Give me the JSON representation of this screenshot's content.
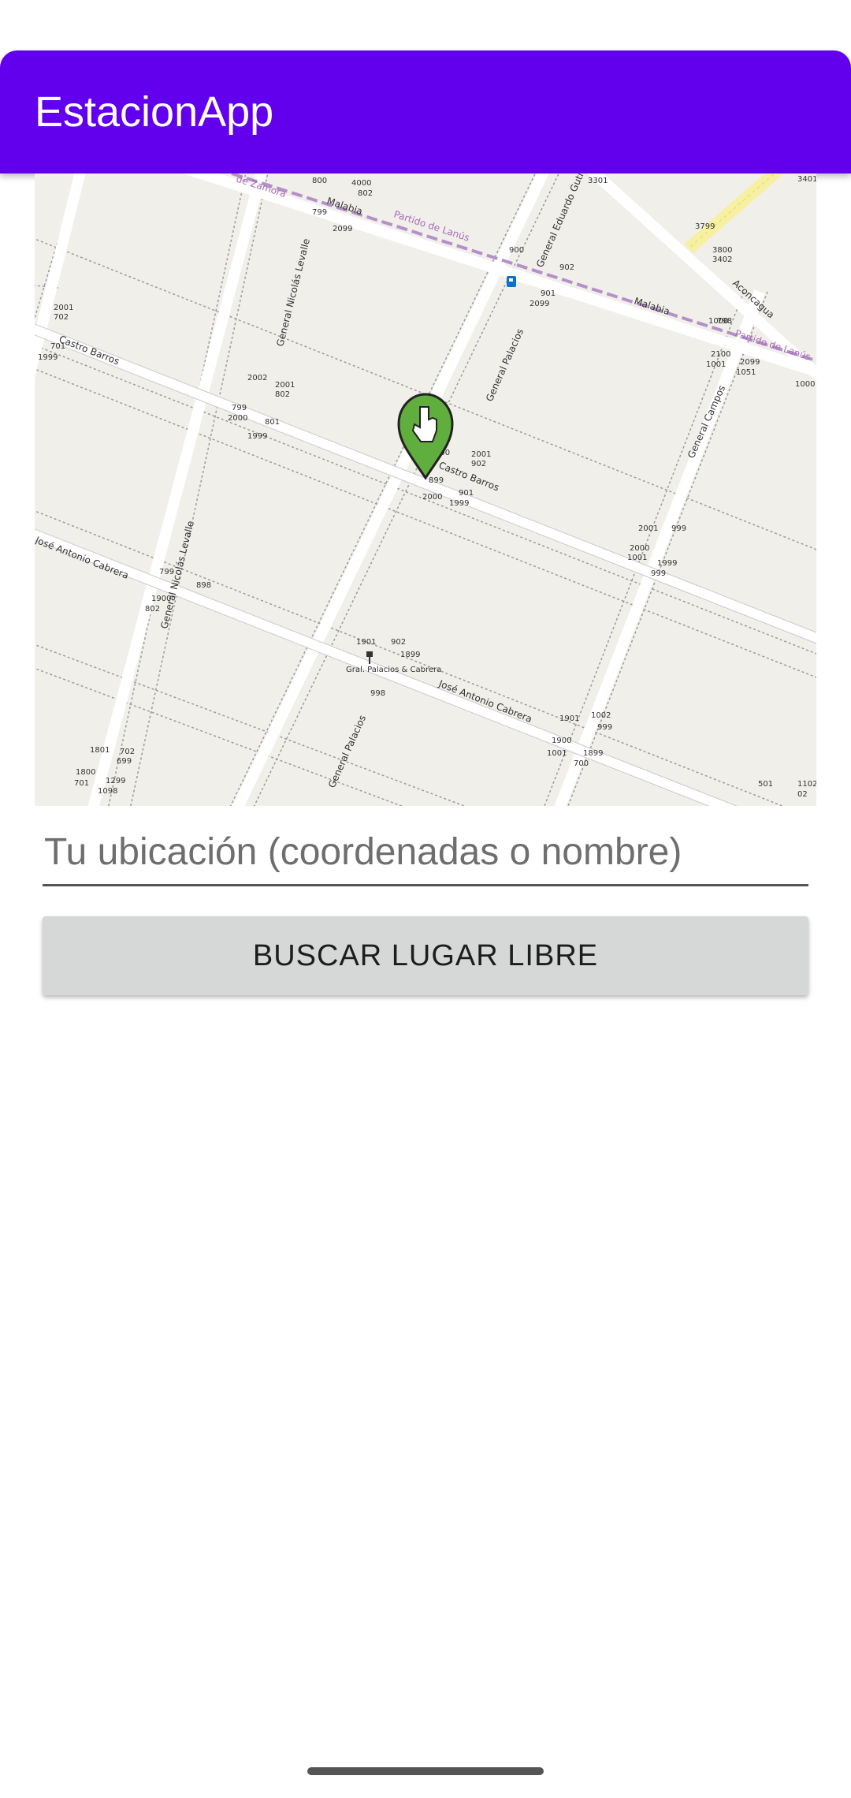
{
  "app_bar": {
    "title": "EstacionApp"
  },
  "map": {
    "streets": [
      "Castro Barros",
      "José Antonio Cabrera",
      "General Nicolás Levalle",
      "General Palacios",
      "General Eduardo Gutierrez",
      "General Campos",
      "Malabia",
      "Aconcagua"
    ],
    "boundary_labels": [
      "Partido de Lanús",
      "de Zamora"
    ],
    "bus_stop_label": "Gral. Palacios & Cabrera",
    "house_numbers": [
      "800",
      "4000",
      "802",
      "799",
      "2099",
      "900",
      "3301",
      "3401",
      "3799",
      "3800",
      "3402",
      "2001",
      "702",
      "701",
      "1999",
      "2002",
      "2001",
      "802",
      "799",
      "2000",
      "801",
      "1999",
      "900",
      "899",
      "2001",
      "902",
      "901",
      "2000",
      "1999",
      "901",
      "2099",
      "902",
      "1000",
      "2001",
      "999",
      "2000",
      "1001",
      "1999",
      "999",
      "2100",
      "1001",
      "2099",
      "1051",
      "1000",
      "798",
      "799",
      "1900",
      "802",
      "898",
      "1901",
      "902",
      "1899",
      "998",
      "1901",
      "1002",
      "999",
      "1900",
      "1001",
      "1899",
      "700",
      "1801",
      "702",
      "699",
      "1800",
      "701",
      "1299",
      "1098",
      "501",
      "1102",
      "02"
    ]
  },
  "location_input": {
    "placeholder": "Tu ubicación (coordenadas o nombre)",
    "value": ""
  },
  "search_button": {
    "label": "BUSCAR LUGAR LIBRE"
  },
  "colors": {
    "primary": "#6200ee",
    "button": "#d6d7d7",
    "map_background": "#f1efea",
    "marker": "#5fae3e"
  }
}
